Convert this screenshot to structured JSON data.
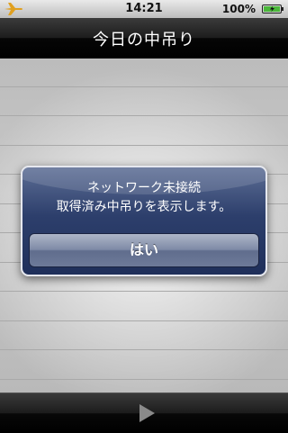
{
  "status_bar": {
    "time": "14:21",
    "battery_percent": "100%",
    "airplane_icon": "airplane-icon",
    "battery_icon": "battery-icon"
  },
  "nav_bar": {
    "title": "今日の中吊り"
  },
  "alert": {
    "title": "ネットワーク未接続",
    "message": "取得済み中吊りを表示します。",
    "button_label": "はい"
  },
  "toolbar": {
    "play_icon": "play-icon"
  },
  "colors": {
    "alert_blue": "#2d3f6c",
    "status_bar_gray": "#d0d0d0",
    "play_icon_gray": "#8a8a8a"
  }
}
